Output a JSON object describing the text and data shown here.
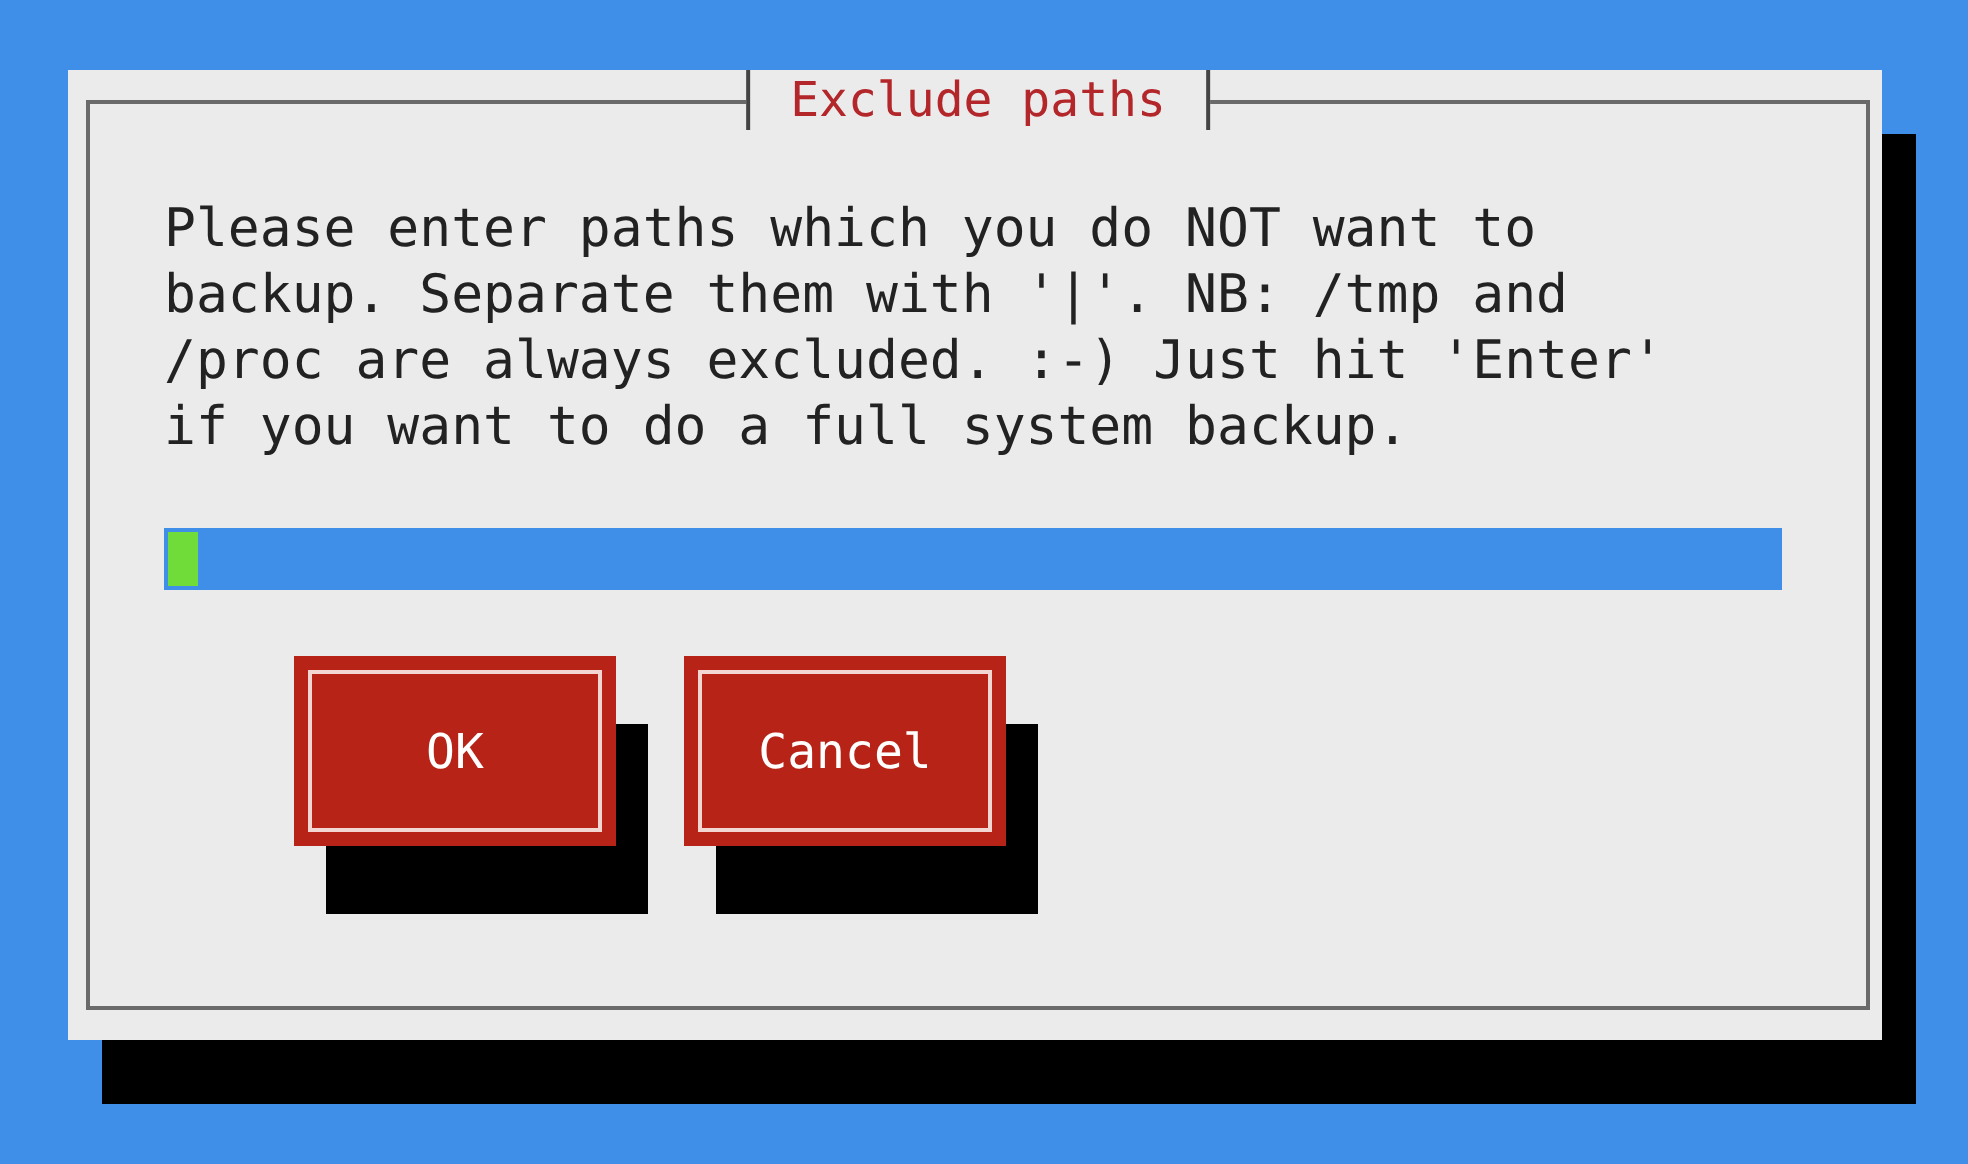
{
  "dialog": {
    "title": "Exclude paths",
    "message": "Please enter paths which you do NOT want to backup. Separate them with '|'. NB: /tmp and /proc are always excluded. :-) Just hit 'Enter' if you want to do a full system backup.",
    "buttons": [
      {
        "label": "OK"
      },
      {
        "label": "Cancel"
      }
    ]
  }
}
